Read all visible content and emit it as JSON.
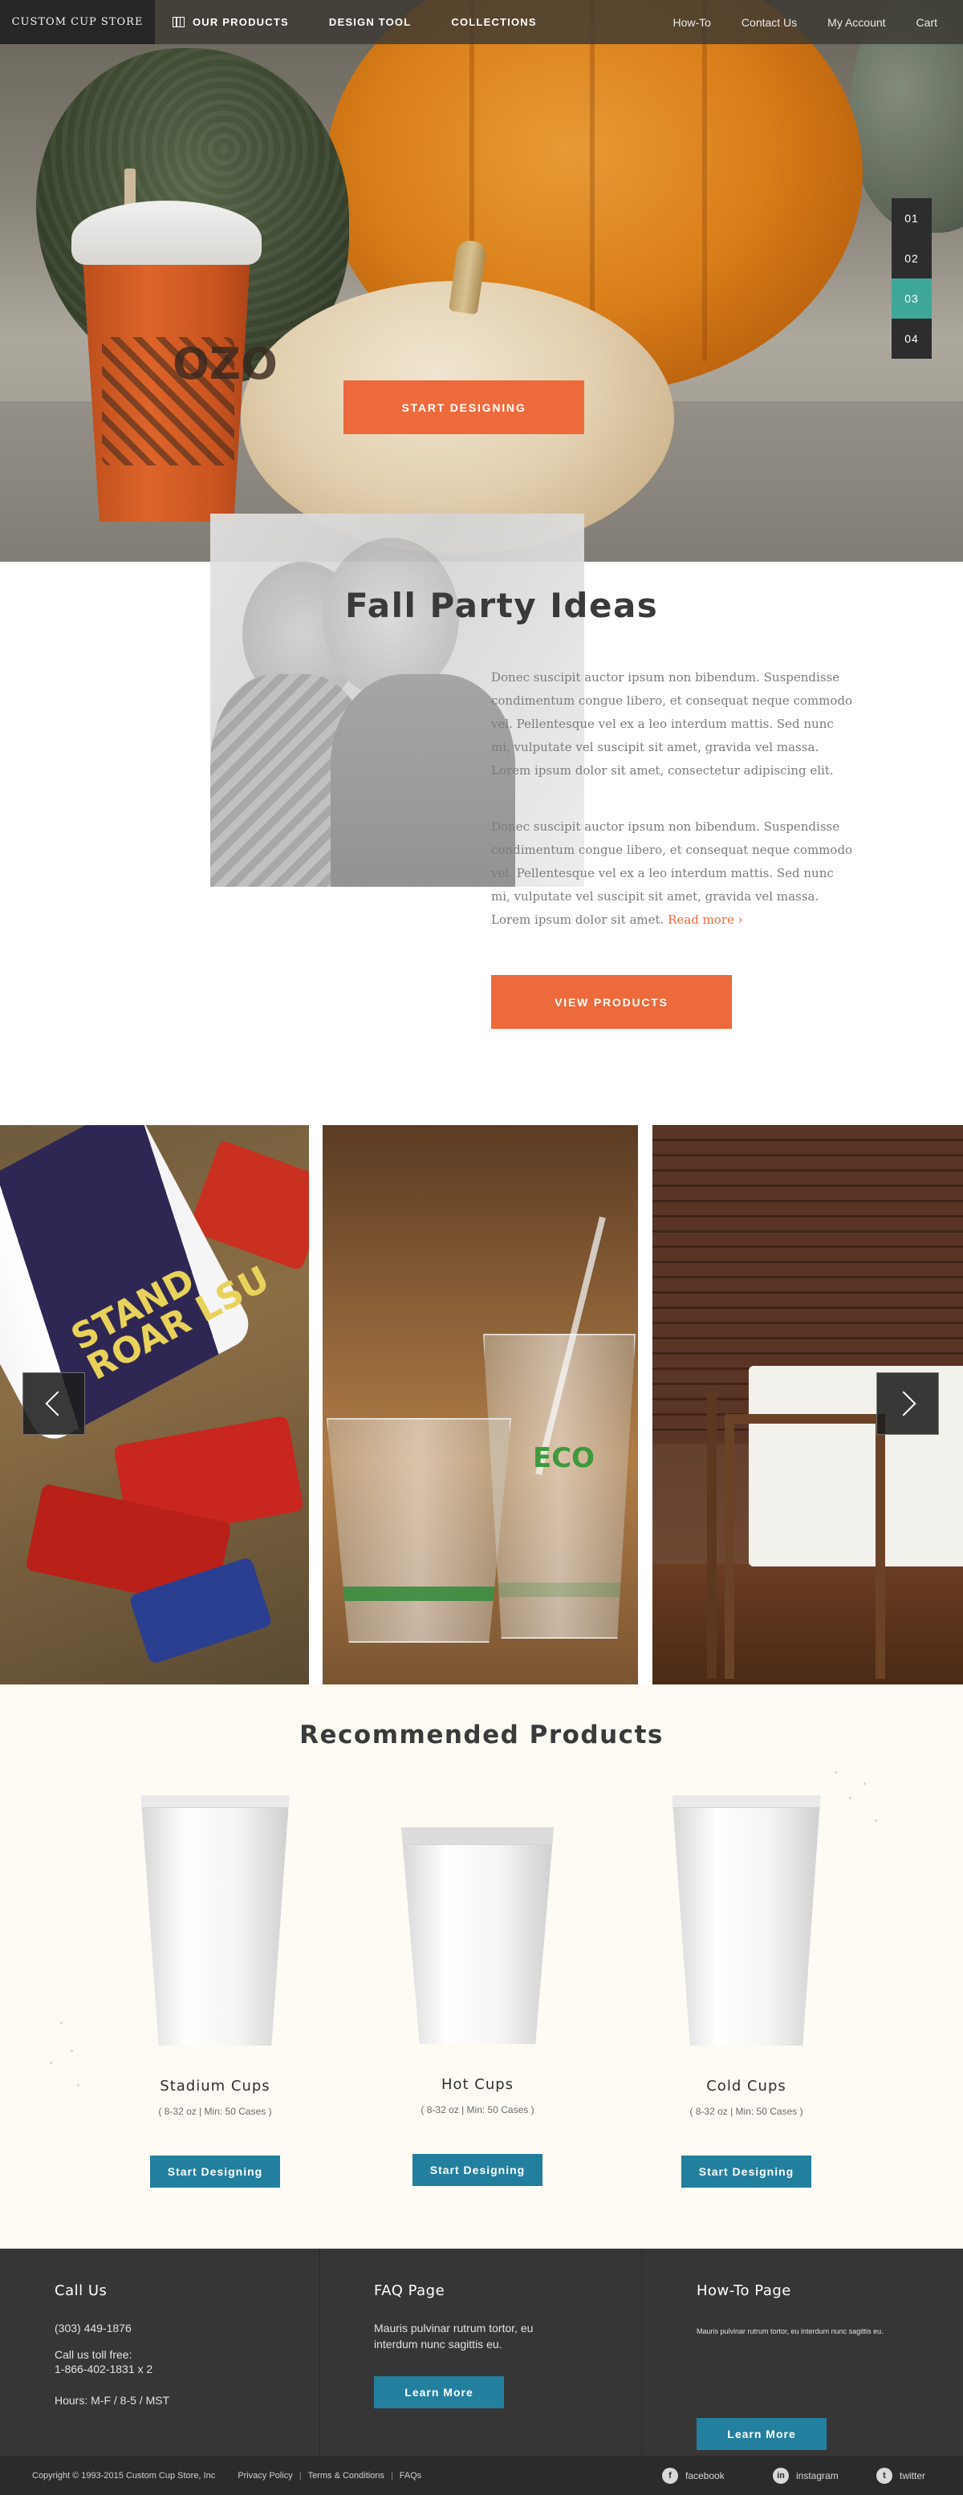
{
  "nav": {
    "brand": "CUSTOM CUP STORE",
    "primary": [
      {
        "label": "OUR PRODUCTS",
        "icon": "grid-icon"
      },
      {
        "label": "DESIGN TOOL"
      },
      {
        "label": "COLLECTIONS"
      }
    ],
    "secondary": [
      {
        "label": "How-To"
      },
      {
        "label": "Contact Us"
      },
      {
        "label": "My Account"
      },
      {
        "label": "Cart"
      }
    ]
  },
  "hero": {
    "cup_logo": "OZO",
    "cta_label": "START DESIGNING",
    "slides": [
      "01",
      "02",
      "03",
      "04"
    ],
    "active_slide": "03",
    "accent_color": "#ec6a3b",
    "active_color": "#3fa79a"
  },
  "party": {
    "title": "Fall Party Ideas",
    "paragraph_1": "Donec suscipit auctor ipsum non bibendum. Suspendisse condimentum congue libero, et consequat neque commodo vel. Pellentesque vel ex a leo interdum mattis. Sed nunc mi, vulputate vel suscipit sit amet, gravida vel massa. Lorem ipsum dolor sit amet, consectetur adipiscing elit.",
    "paragraph_2": "Donec suscipit auctor ipsum non bibendum. Suspendisse condimentum congue libero, et consequat neque commodo vel. Pellentesque vel ex a leo interdum mattis. Sed nunc mi, vulputate vel suscipit sit amet, gravida vel massa. Lorem ipsum dolor sit amet.",
    "read_more": "Read more ›",
    "cta_label": "VIEW PRODUCTS"
  },
  "gallery": {
    "prev_icon": "chevron-left-icon",
    "next_icon": "chevron-right-icon",
    "tile_1_text": "STAND ROAR LSU",
    "tile_2_text": "ECO"
  },
  "recommended": {
    "title": "Recommended Products",
    "products": [
      {
        "name": "Stadium Cups",
        "spec": "( 8-32 oz | Min: 50 Cases )",
        "button": "Start Designing"
      },
      {
        "name": "Hot Cups",
        "spec": "( 8-32 oz | Min: 50 Cases )",
        "button": "Start Designing"
      },
      {
        "name": "Cold Cups",
        "spec": "( 8-32 oz | Min: 50 Cases )",
        "button": "Start Designing"
      }
    ],
    "button_color": "#237f9e"
  },
  "footer": {
    "call": {
      "title": "Call Us",
      "phone": "(303) 449-1876",
      "toll_label": "Call us toll free:",
      "toll_number": "1-866-402-1831 x 2",
      "hours": "Hours: M-F / 8-5 / MST"
    },
    "faq": {
      "title": "FAQ Page",
      "desc": "Mauris pulvinar rutrum tortor, eu interdum nunc sagittis eu.",
      "button": "Learn More"
    },
    "howto": {
      "title": "How-To Page",
      "desc": "Mauris pulvinar rutrum tortor, eu interdum nunc sagittis eu.",
      "button": "Learn More"
    }
  },
  "bottom": {
    "copyright": "Copyright © 1993-2015 Custom Cup Store, Inc",
    "links": [
      "Privacy Policy",
      "Terms & Conditions",
      "FAQs"
    ],
    "social": [
      {
        "label": "facebook",
        "icon": "facebook-icon",
        "glyph": "f"
      },
      {
        "label": "instagram",
        "icon": "instagram-icon",
        "glyph": "in"
      },
      {
        "label": "twitter",
        "icon": "twitter-icon",
        "glyph": "t"
      }
    ]
  }
}
